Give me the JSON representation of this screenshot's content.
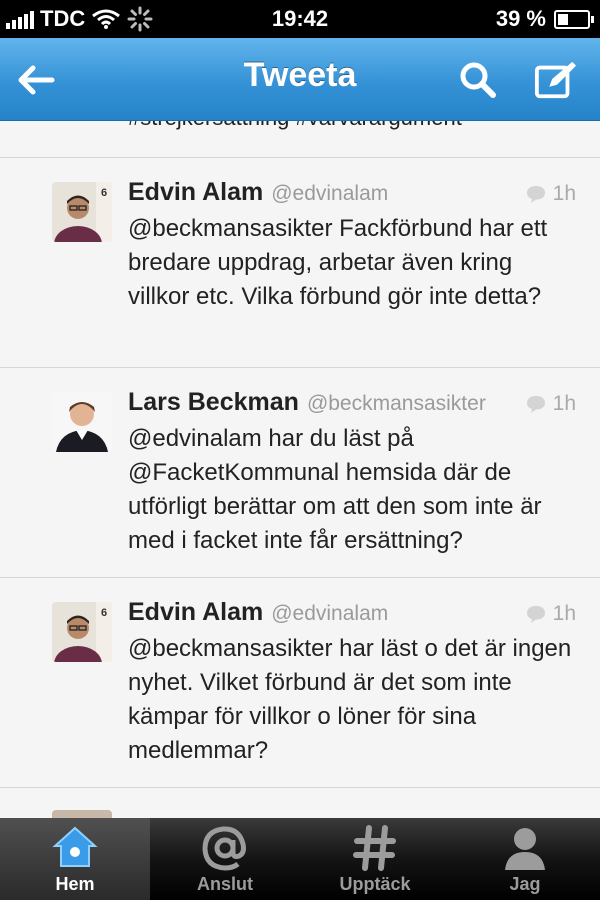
{
  "status_bar": {
    "carrier": "TDC",
    "time": "19:42",
    "battery": "39 %"
  },
  "nav": {
    "title": "Tweeta",
    "back_icon": "arrow-left-icon",
    "search_icon": "search-icon",
    "compose_icon": "compose-icon"
  },
  "timeline": {
    "cut_text": "#strejkersättning #värvarargument",
    "tweets": [
      {
        "name": "Edvin Alam",
        "handle": "@edvinalam",
        "time": "1h",
        "text": "@beckmansasikter Fackförbund har ett bredare uppdrag, arbetar även kring villkor etc. Vilka förbund gör inte detta?",
        "avatar_badge": "6"
      },
      {
        "name": "Lars Beckman",
        "handle": "@beckmansasikter",
        "time": "1h",
        "text": "@edvinalam har du läst på @FacketKommunal hemsida där de utförligt berättar om att den som inte är med i facket inte får ersättning?"
      },
      {
        "name": "Edvin Alam",
        "handle": "@edvinalam",
        "time": "1h",
        "text": "@beckmansasikter har läst o det är ingen nyhet. Vilket förbund är det som inte kämpar för villkor o löner för sina medlemmar?",
        "avatar_badge": "6"
      }
    ]
  },
  "tabs": [
    {
      "label": "Hem",
      "icon": "home-icon",
      "active": true
    },
    {
      "label": "Anslut",
      "icon": "at-icon",
      "active": false
    },
    {
      "label": "Upptäck",
      "icon": "hashtag-icon",
      "active": false
    },
    {
      "label": "Jag",
      "icon": "person-icon",
      "active": false
    }
  ],
  "colors": {
    "nav_blue": "#3592d6",
    "text": "#222222",
    "muted": "#9a9a9a"
  }
}
